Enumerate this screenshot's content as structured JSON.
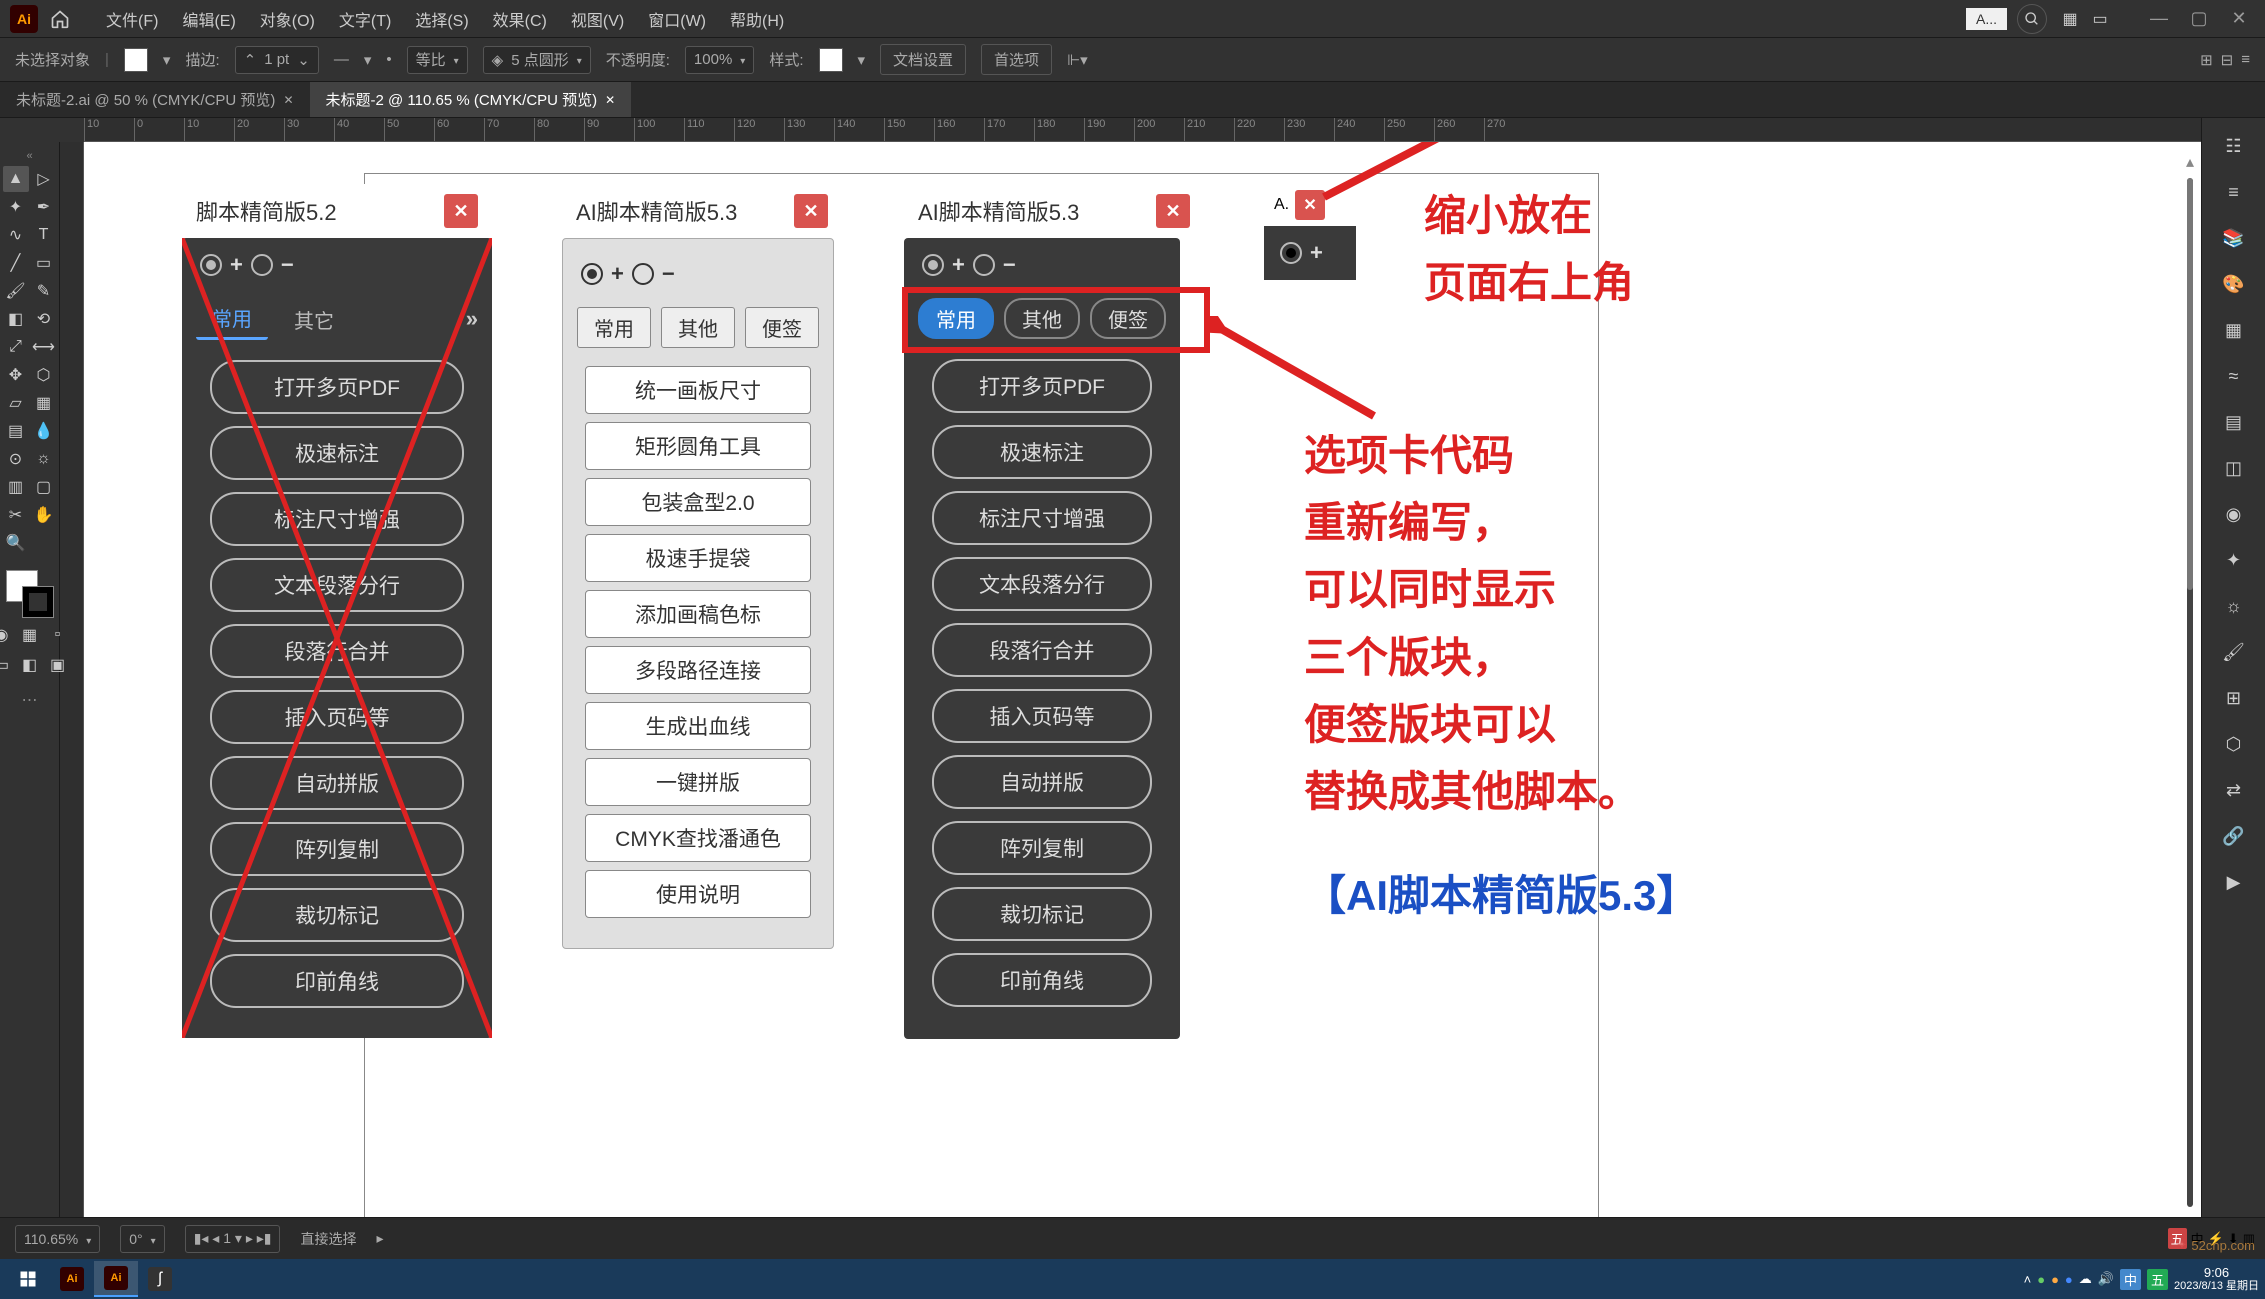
{
  "menubar": {
    "items": [
      "文件(F)",
      "编辑(E)",
      "对象(O)",
      "文字(T)",
      "选择(S)",
      "效果(C)",
      "视图(V)",
      "窗口(W)",
      "帮助(H)"
    ],
    "mini_panel_label": "A..."
  },
  "controlbar": {
    "no_selection": "未选择对象",
    "stroke_label": "描边:",
    "stroke_value": "1 pt",
    "uniform": "等比",
    "corner_value": "5 点圆形",
    "opacity_label": "不透明度:",
    "opacity_value": "100%",
    "style_label": "样式:",
    "doc_setup": "文档设置",
    "prefs": "首选项"
  },
  "tabs": [
    {
      "label": "未标题-2.ai @ 50 % (CMYK/CPU 预览)",
      "active": false
    },
    {
      "label": "未标题-2 @ 110.65 % (CMYK/CPU 预览)",
      "active": true
    }
  ],
  "statusbar": {
    "zoom": "110.65%",
    "tool": "直接选择"
  },
  "left_tools": [
    "selection",
    "direct",
    "wand",
    "pen",
    "curvature",
    "type",
    "line",
    "rect",
    "brush",
    "pencil",
    "eraser",
    "rotate",
    "scale",
    "width",
    "free",
    "shape-builder",
    "perspective",
    "mesh",
    "gradient",
    "eyedropper",
    "blend",
    "symbol",
    "column",
    "artboard",
    "slice",
    "hand",
    "zoom"
  ],
  "right_tools": [
    "properties",
    "layers",
    "libraries",
    "color",
    "swatches",
    "stroke",
    "gradient",
    "transparency",
    "appearance",
    "graphic-styles",
    "symbols",
    "brushes",
    "align",
    "pathfinder",
    "transform",
    "links",
    "play"
  ],
  "ruler_ticks": [
    "10",
    "0",
    "10",
    "20",
    "30",
    "40",
    "50",
    "60",
    "70",
    "80",
    "90",
    "100",
    "110",
    "120",
    "130",
    "140",
    "150",
    "160",
    "170",
    "180",
    "190",
    "200",
    "210",
    "220",
    "230",
    "240",
    "250",
    "260",
    "270"
  ],
  "panel52": {
    "title": "脚本精简版5.2",
    "tabs": [
      "常用",
      "其它"
    ],
    "buttons": [
      "打开多页PDF",
      "极速标注",
      "标注尺寸增强",
      "文本段落分行",
      "段落行合并",
      "插入页码等",
      "自动拼版",
      "阵列复制",
      "裁切标记",
      "印前角线"
    ]
  },
  "panel53light": {
    "title": "AI脚本精简版5.3",
    "tabs": [
      "常用",
      "其他",
      "便签"
    ],
    "buttons": [
      "统一画板尺寸",
      "矩形圆角工具",
      "包装盒型2.0",
      "极速手提袋",
      "添加画稿色标",
      "多段路径连接",
      "生成出血线",
      "一键拼版",
      "CMYK查找潘通色",
      "使用说明"
    ]
  },
  "panel53dark": {
    "title": "AI脚本精简版5.3",
    "tabs": [
      "常用",
      "其他",
      "便签"
    ],
    "buttons": [
      "打开多页PDF",
      "极速标注",
      "标注尺寸增强",
      "文本段落分行",
      "段落行合并",
      "插入页码等",
      "自动拼版",
      "阵列复制",
      "裁切标记",
      "印前角线"
    ]
  },
  "mini": {
    "title": "A."
  },
  "annot": {
    "line1": "缩小放在",
    "line2": "页面右上角",
    "body": "选项卡代码\n重新编写，\n可以同时显示\n三个版块，\n便签版块可以\n替换成其他脚本。",
    "blue": "【AI脚本精简版5.3】"
  },
  "taskbar": {
    "time": "9:06",
    "date": "2023/8/13 星期日"
  },
  "watermark": "52cnp.com",
  "tray_chinese": "中"
}
